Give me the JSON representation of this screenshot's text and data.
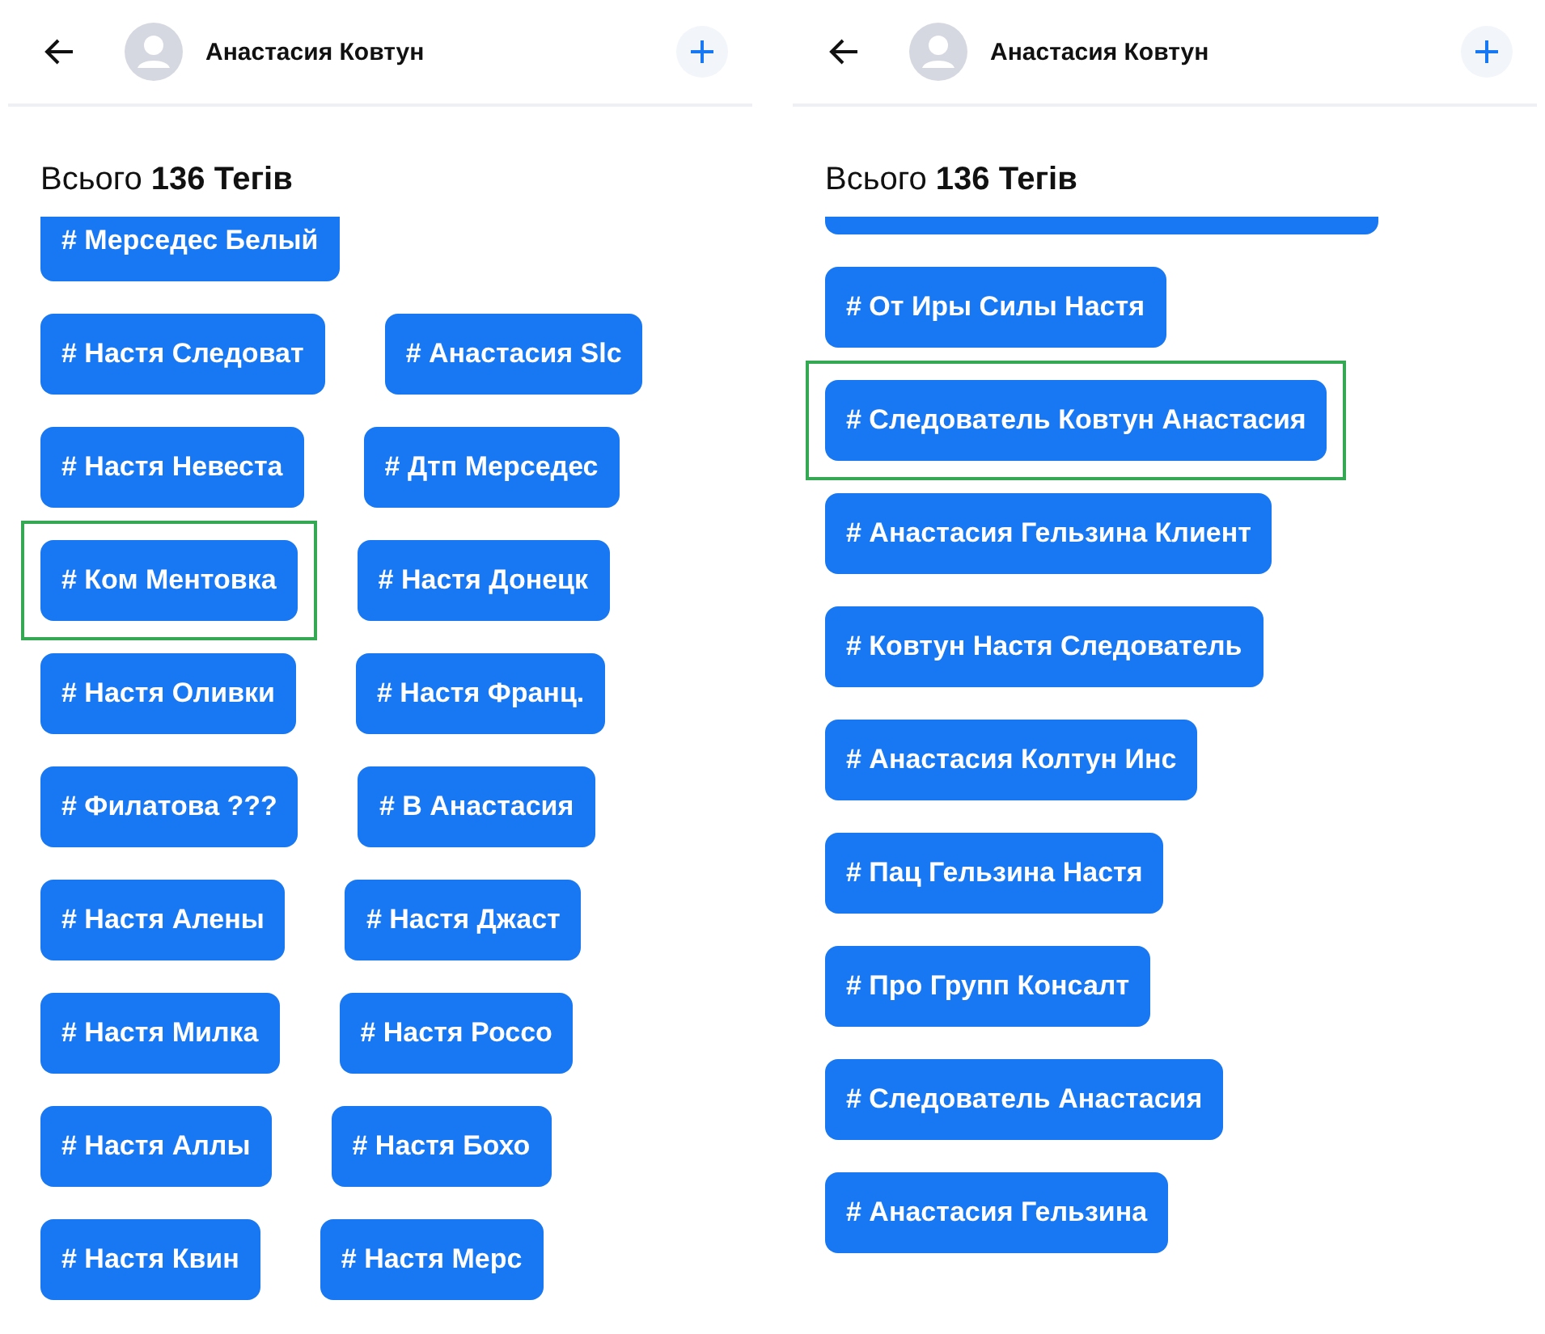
{
  "panels": [
    {
      "contact": "Анастасия Ковтун",
      "total": "Всього **136 Тегів**",
      "rows": [
        {
          "tags": [
            {
              "label": "# Мерседес Белый",
              "highlighted": false
            }
          ]
        },
        {
          "tags": [
            {
              "label": "# Настя Следоват",
              "highlighted": false
            },
            {
              "label": "# Анастасия Slc",
              "highlighted": false
            }
          ]
        },
        {
          "tags": [
            {
              "label": "# Настя Невеста",
              "highlighted": false
            },
            {
              "label": "# Дтп Мерседес",
              "highlighted": false
            }
          ]
        },
        {
          "tags": [
            {
              "label": "# Ком Ментовка",
              "highlighted": true
            },
            {
              "label": "# Настя Донецк",
              "highlighted": false
            }
          ]
        },
        {
          "tags": [
            {
              "label": "# Настя Оливки",
              "highlighted": false
            },
            {
              "label": "# Настя Франц.",
              "highlighted": false
            }
          ]
        },
        {
          "tags": [
            {
              "label": "# Филатова ???",
              "highlighted": false
            },
            {
              "label": "# В Анастасия",
              "highlighted": false
            }
          ]
        },
        {
          "tags": [
            {
              "label": "# Настя Алены",
              "highlighted": false
            },
            {
              "label": "# Настя Джаст",
              "highlighted": false
            }
          ]
        },
        {
          "tags": [
            {
              "label": "# Настя Милка",
              "highlighted": false
            },
            {
              "label": "# Настя Россо",
              "highlighted": false
            }
          ]
        },
        {
          "tags": [
            {
              "label": "# Настя Аллы",
              "highlighted": false
            },
            {
              "label": "# Настя Бохо",
              "highlighted": false
            }
          ]
        },
        {
          "tags": [
            {
              "label": "# Настя Квин",
              "highlighted": false
            },
            {
              "label": "# Настя Мерс",
              "highlighted": false
            }
          ]
        }
      ]
    },
    {
      "contact": "Анастасия Ковтун",
      "total": "Всього **136 Тегів**",
      "rows": [
        {
          "tags": [
            {
              "label": "# От Иры Силы Настя",
              "highlighted": false
            }
          ]
        },
        {
          "tags": [
            {
              "label": "# Следователь Ковтун Анастасия",
              "highlighted": true
            }
          ]
        },
        {
          "tags": [
            {
              "label": "# Анастасия Гельзина Клиент",
              "highlighted": false
            }
          ]
        },
        {
          "tags": [
            {
              "label": "# Ковтун Настя Следователь",
              "highlighted": false
            }
          ]
        },
        {
          "tags": [
            {
              "label": "# Анастасия Колтун Инс",
              "highlighted": false
            }
          ]
        },
        {
          "tags": [
            {
              "label": "# Пац Гельзина Настя",
              "highlighted": false
            }
          ]
        },
        {
          "tags": [
            {
              "label": "# Про Групп Консалт",
              "highlighted": false
            }
          ]
        },
        {
          "tags": [
            {
              "label": "# Следователь Анастасия",
              "highlighted": false
            }
          ]
        },
        {
          "tags": [
            {
              "label": "# Анастасия Гельзина",
              "highlighted": false
            }
          ]
        }
      ]
    }
  ]
}
